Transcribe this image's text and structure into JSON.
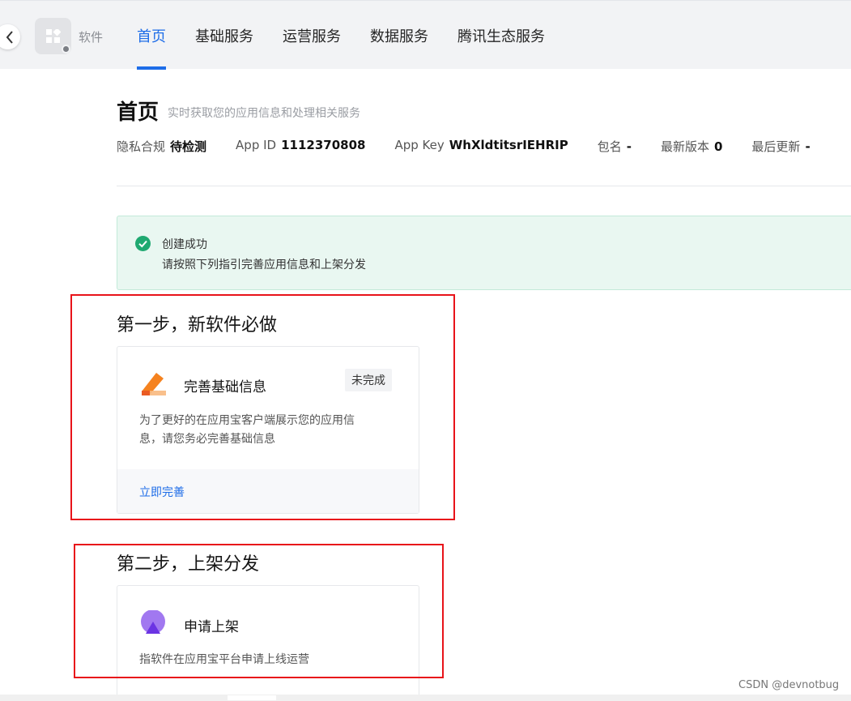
{
  "header": {
    "app_name": "软件",
    "tabs": [
      {
        "label": "首页",
        "active": true
      },
      {
        "label": "基础服务",
        "active": false
      },
      {
        "label": "运营服务",
        "active": false
      },
      {
        "label": "数据服务",
        "active": false
      },
      {
        "label": "腾讯生态服务",
        "active": false
      }
    ]
  },
  "page": {
    "title": "首页",
    "subtitle": "实时获取您的应用信息和处理相关服务",
    "info": [
      {
        "label": "隐私合规",
        "value": "待检测"
      },
      {
        "label": "App ID",
        "value": "1112370808"
      },
      {
        "label": "App Key",
        "value": "WhXldtitsrIEHRIP"
      },
      {
        "label": "包名",
        "value": "-"
      },
      {
        "label": "最新版本",
        "value": "0"
      },
      {
        "label": "最后更新",
        "value": "-"
      }
    ]
  },
  "banner": {
    "title": "创建成功",
    "description": "请按照下列指引完善应用信息和上架分发"
  },
  "steps": [
    {
      "title": "第一步，新软件必做",
      "card": {
        "title": "完善基础信息",
        "badge": "未完成",
        "description_line1": "为了更好的在应用宝客户端展示您的应用信",
        "description_line2": "息，请您务必完善基础信息",
        "action": "立即完善"
      }
    },
    {
      "title": "第二步，上架分发",
      "card": {
        "title": "申请上架",
        "description_line1": "指软件在应用宝平台申请上线运营"
      }
    }
  ],
  "watermark": "CSDN @devnotbug",
  "colors": {
    "accent": "#1e6de8",
    "success": "#1fa971",
    "highlight": "#e8131a"
  }
}
